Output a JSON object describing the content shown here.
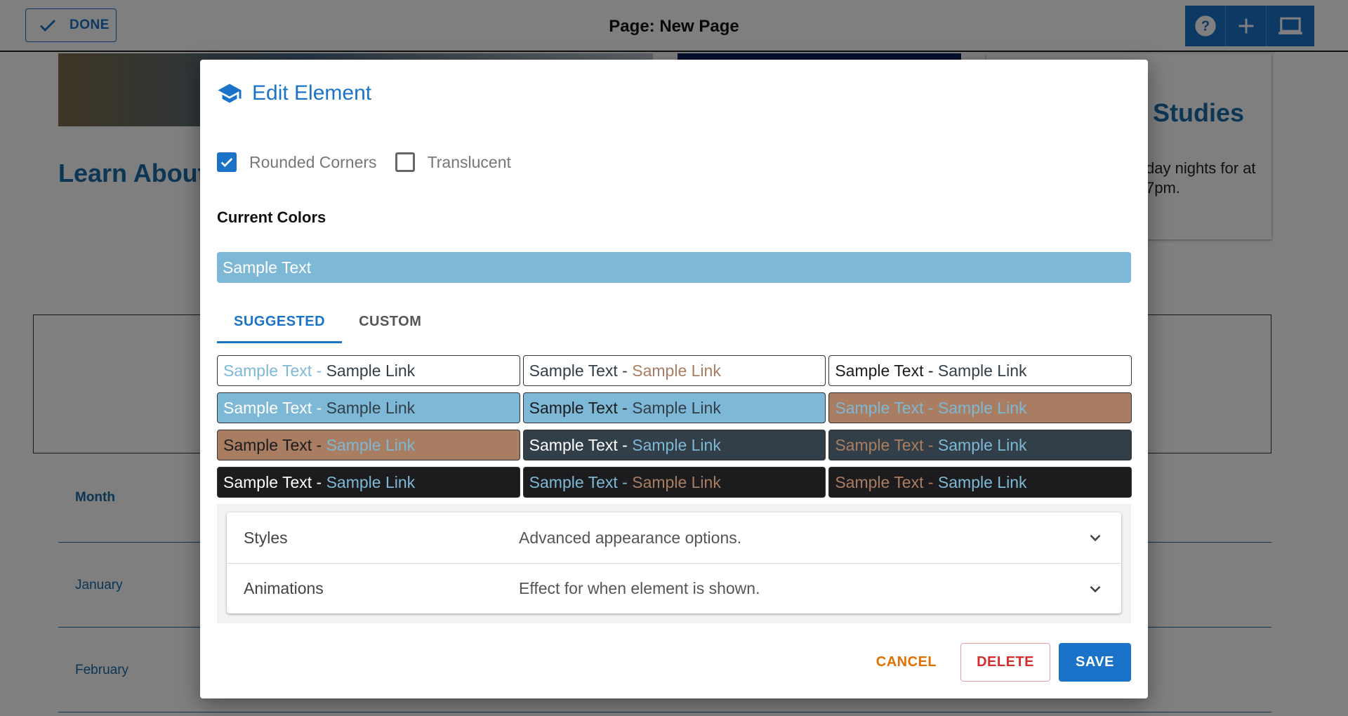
{
  "topbar": {
    "done_label": "DONE",
    "title": "Page: New Page"
  },
  "background": {
    "heading_left": "Learn About",
    "heading_right": "Studies",
    "para_right": "day nights for at 7pm.",
    "table_header": "Month",
    "rows": [
      "January",
      "February"
    ]
  },
  "modal": {
    "title": "Edit Element",
    "options": [
      {
        "label": "Rounded Corners",
        "checked": true
      },
      {
        "label": "Translucent",
        "checked": false
      }
    ],
    "current_colors_label": "Current Colors",
    "current_sample": "Sample Text",
    "tabs": [
      "SUGGESTED",
      "CUSTOM"
    ],
    "swatch_text": "Sample Text",
    "swatch_sep": " - ",
    "swatch_link": "Sample Link",
    "swatches": [
      {
        "bg": "#ffffff",
        "text": "#7db8d6",
        "link": "#333f48"
      },
      {
        "bg": "#ffffff",
        "text": "#333f48",
        "link": "#a97d62"
      },
      {
        "bg": "#ffffff",
        "text": "#1c1c1e",
        "link": "#333f48"
      },
      {
        "bg": "#7db8d6",
        "text": "#ffffff",
        "link": "#333f48"
      },
      {
        "bg": "#7db8d6",
        "text": "#1c1c1e",
        "link": "#333f48"
      },
      {
        "bg": "#a97d62",
        "text": "#7db8d6",
        "link": "#7db8d6"
      },
      {
        "bg": "#a97d62",
        "text": "#1c1c1e",
        "link": "#7db8d6"
      },
      {
        "bg": "#333f48",
        "text": "#ffffff",
        "link": "#7db8d6"
      },
      {
        "bg": "#333f48",
        "text": "#a97d62",
        "link": "#7db8d6"
      },
      {
        "bg": "#1c1c1e",
        "text": "#ffffff",
        "link": "#7db8d6"
      },
      {
        "bg": "#1c1c1e",
        "text": "#7db8d6",
        "link": "#a97d62"
      },
      {
        "bg": "#1c1c1e",
        "text": "#a97d62",
        "link": "#7db8d6"
      }
    ],
    "accordion": [
      {
        "title": "Styles",
        "desc": "Advanced appearance options."
      },
      {
        "title": "Animations",
        "desc": "Effect for when element is shown."
      }
    ],
    "buttons": {
      "cancel": "CANCEL",
      "delete": "DELETE",
      "save": "SAVE"
    }
  },
  "colors": {
    "accent": "#1a73c8",
    "cancel": "#e07000",
    "delete": "#d32f2f"
  }
}
